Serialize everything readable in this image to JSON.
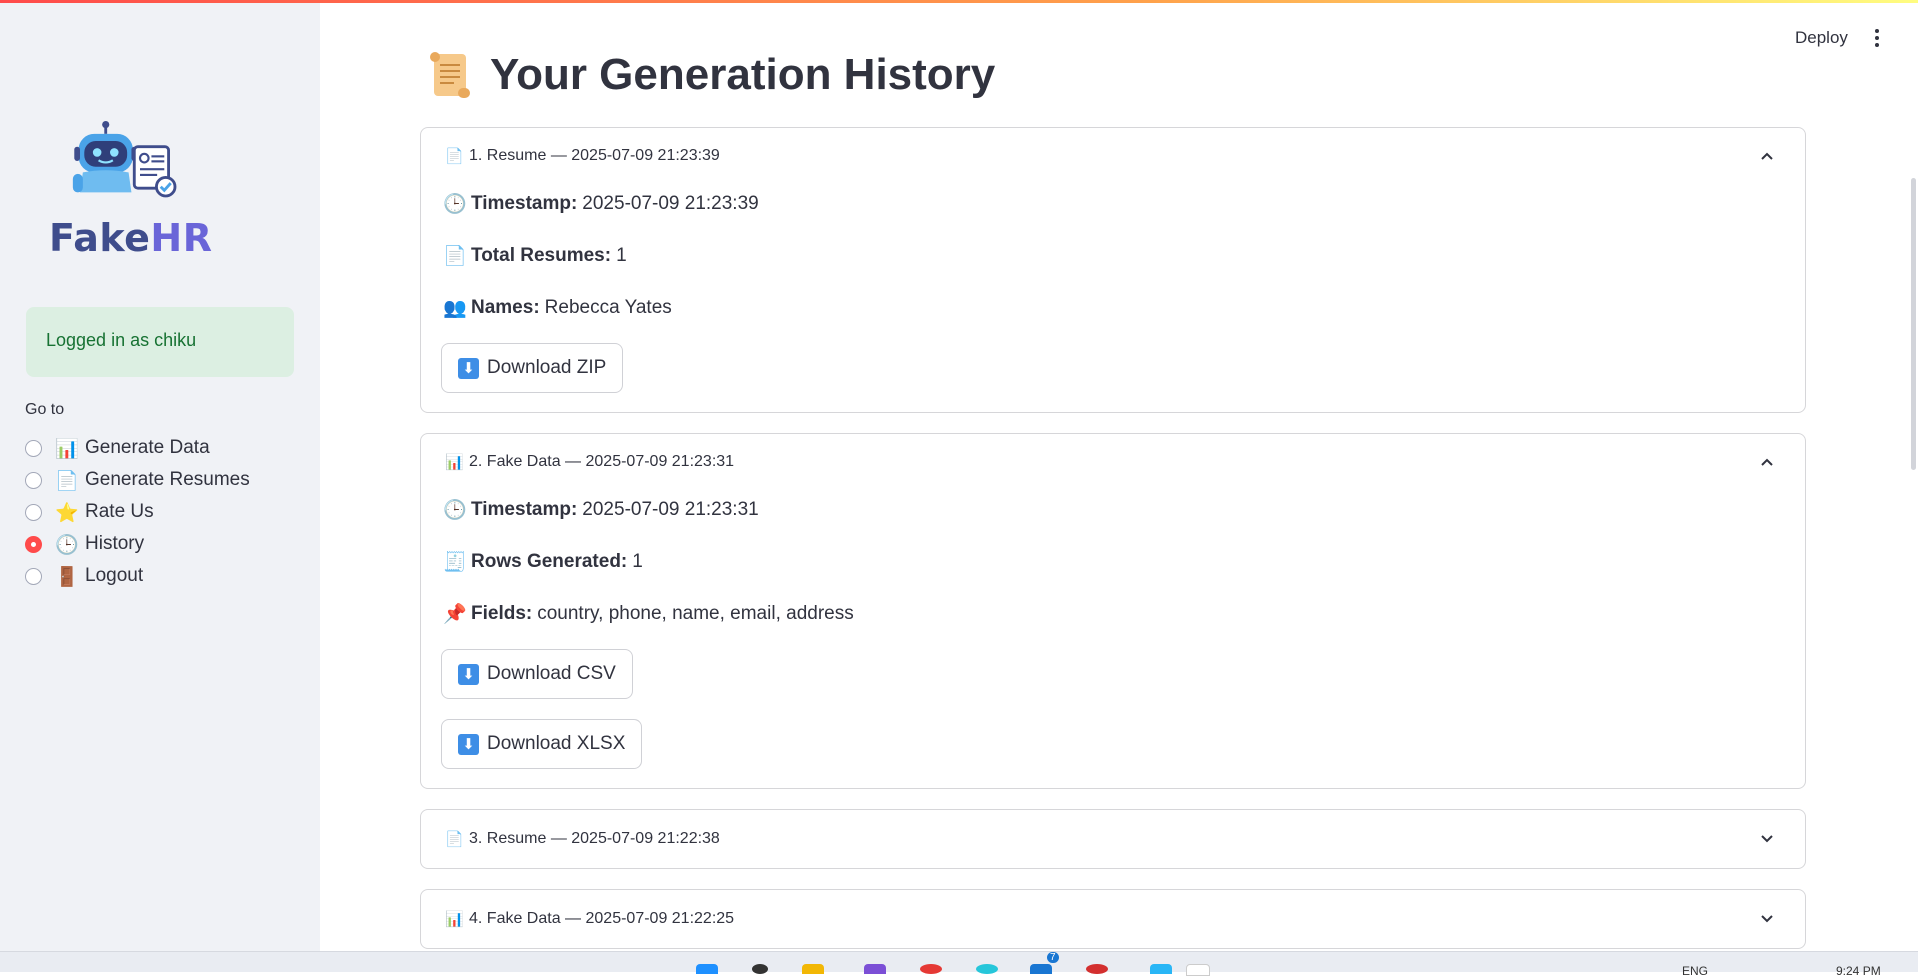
{
  "app": {
    "deploy_label": "Deploy"
  },
  "sidebar": {
    "logo_text_a": "Fake",
    "logo_text_b": "HR",
    "logged_in": "Logged in as chiku",
    "nav_label": "Go to",
    "items": [
      {
        "icon": "📊",
        "label": "Generate Data",
        "selected": false
      },
      {
        "icon": "📄",
        "label": "Generate Resumes",
        "selected": false
      },
      {
        "icon": "⭐",
        "label": "Rate Us",
        "selected": false
      },
      {
        "icon": "🕒",
        "label": "History",
        "selected": true
      },
      {
        "icon": "🚪",
        "label": "Logout",
        "selected": false
      }
    ]
  },
  "main": {
    "title": "Your Generation History",
    "entries": [
      {
        "header": "1. Resume — 2025-07-09 21:23:39",
        "icon": "📄",
        "expanded": true,
        "timestamp_label": "Timestamp:",
        "timestamp": "2025-07-09 21:23:39",
        "count_label": "Total Resumes:",
        "count": "1",
        "names_label": "Names:",
        "names": "Rebecca Yates",
        "buttons": [
          "Download ZIP"
        ]
      },
      {
        "header": "2. Fake Data — 2025-07-09 21:23:31",
        "icon": "📊",
        "expanded": true,
        "timestamp_label": "Timestamp:",
        "timestamp": "2025-07-09 21:23:31",
        "rows_label": "Rows Generated:",
        "rows": "1",
        "fields_label": "Fields:",
        "fields": "country, phone, name, email, address",
        "buttons": [
          "Download CSV",
          "Download XLSX"
        ]
      },
      {
        "header": "3. Resume — 2025-07-09 21:22:38",
        "icon": "📄",
        "expanded": false
      },
      {
        "header": "4. Fake Data — 2025-07-09 21:22:25",
        "icon": "📊",
        "expanded": false
      }
    ]
  },
  "taskbar": {
    "lang": "ENG",
    "time": "9:24 PM",
    "badge": "7"
  }
}
